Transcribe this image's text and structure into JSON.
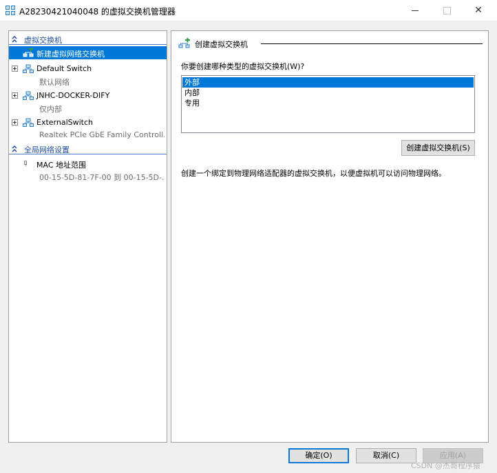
{
  "window": {
    "title": "A28230421040048 的虚拟交换机管理器",
    "close_glyph": "✕"
  },
  "sidebar": {
    "virtual_switches_header": "虚拟交换机",
    "new_switch_item": "新建虚拟网络交换机",
    "switches": [
      {
        "name": "Default Switch",
        "detail": "默认网络"
      },
      {
        "name": "JNHC-DOCKER-DIFY",
        "detail": "仅内部"
      },
      {
        "name": "ExternalSwitch",
        "detail": "Realtek PCIe GbE Family Controll..."
      }
    ],
    "global_header": "全局网络设置",
    "mac_range": {
      "name": "MAC 地址范围",
      "detail": "00-15-5D-81-7F-00 到 00-15-5D-..."
    }
  },
  "main": {
    "section_title": "创建虚拟交换机",
    "question": "你要创建哪种类型的虚拟交换机(W)?",
    "switch_types": [
      "外部",
      "内部",
      "专用"
    ],
    "selected_type": "外部",
    "create_button": "创建虚拟交换机(S)",
    "description": "创建一个绑定到物理网络适配器的虚拟交换机，以便虚拟机可以访问物理网络。"
  },
  "footer": {
    "ok": "确定(O)",
    "cancel": "取消(C)",
    "apply": "应用(A)",
    "watermark": "CSDN @杰哥程序猿"
  },
  "colors": {
    "accent": "#0078d7",
    "header_text": "#1f4e9e",
    "network_icon": "#2d7fc9",
    "add_green": "#2ea043"
  }
}
